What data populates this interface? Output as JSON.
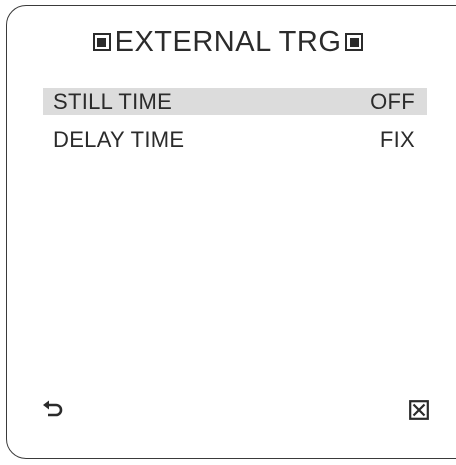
{
  "menu": {
    "title": "EXTERNAL TRG",
    "items": [
      {
        "label": "STILL TIME",
        "value": "OFF",
        "selected": true
      },
      {
        "label": "DELAY TIME",
        "value": "FIX",
        "selected": false
      }
    ]
  },
  "footer": {
    "back_icon": "return-arrow-icon",
    "close_icon": "close-box-icon"
  },
  "colors": {
    "text": "#2b2b2b",
    "highlight": "#dcdcdc",
    "border": "#3a3a3a",
    "background": "#ffffff"
  }
}
